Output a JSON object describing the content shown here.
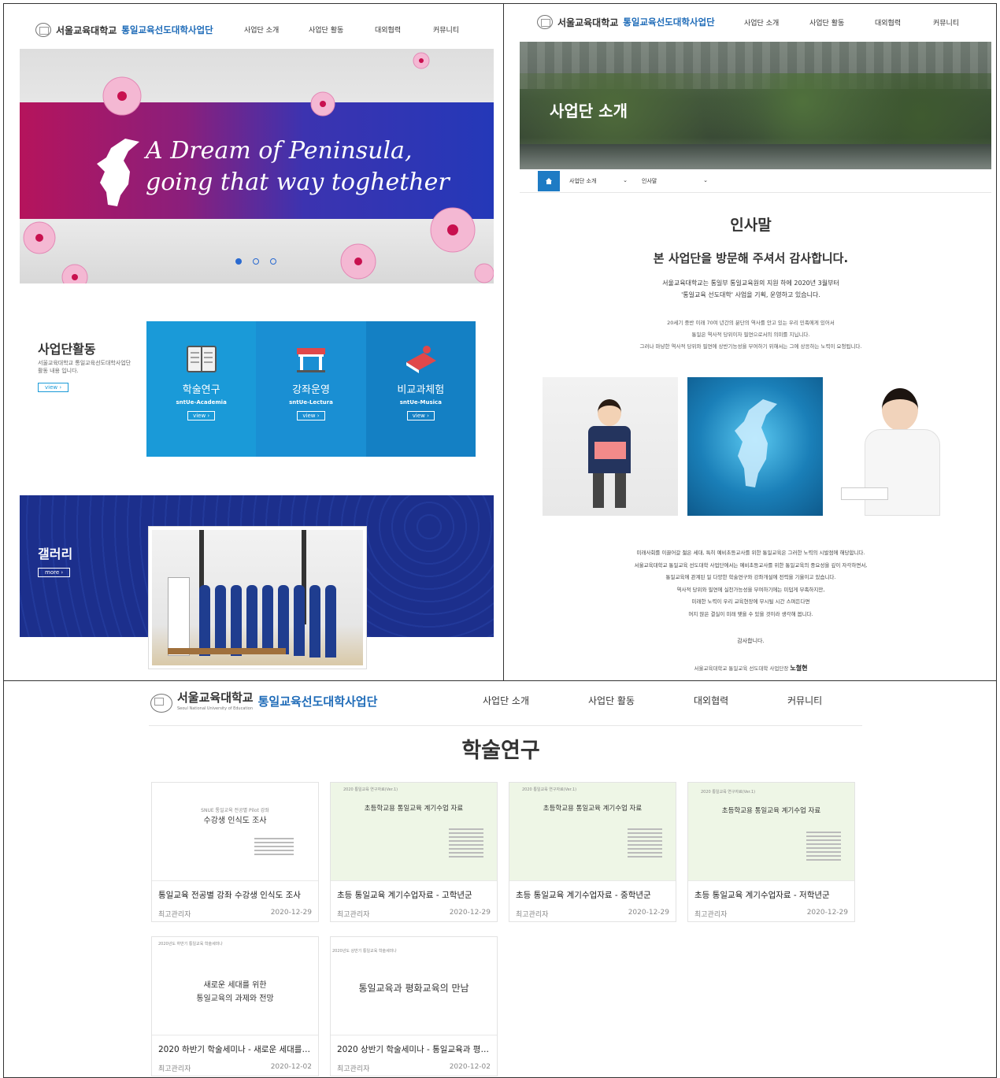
{
  "home": {
    "logo_ko": "서울교육대학교",
    "logo_unit": "통일교육선도대학사업단",
    "nav": [
      "사업단 소개",
      "사업단 활동",
      "대외협력",
      "커뮤니티"
    ],
    "hero_line1": "A Dream of Peninsula,",
    "hero_line2": "going that way toghether",
    "activity_title": "사업단활동",
    "activity_desc1": "서울교육대학교 통일교육선도대학사업단",
    "activity_desc2": "활동 내용 입니다.",
    "view_label": "view",
    "tiles": [
      {
        "title": "학술연구",
        "sub": "sntUe-Academia",
        "btn": "view"
      },
      {
        "title": "강좌운영",
        "sub": "sntUe-Lectura",
        "btn": "view"
      },
      {
        "title": "비교과체험",
        "sub": "sntUe-Musica",
        "btn": "view"
      }
    ],
    "gallery_title": "갤러리",
    "more_label": "more"
  },
  "about": {
    "logo_ko": "서울교육대학교",
    "logo_unit": "통일교육선도대학사업단",
    "nav": [
      "사업단 소개",
      "사업단 활동",
      "대외협력",
      "커뮤니티"
    ],
    "banner_title": "사업단 소개",
    "crumb1": "사업단 소개",
    "crumb2": "인사말",
    "heading": "인사말",
    "subheading": "본 사업단을 방문해 주셔서 감사합니다.",
    "intro1": "서울교육대학교는 통일부 통일교육원의 지원 하에 2020년 3월부터",
    "intro2": "'통일교육 선도대학' 사업을 기획, 운영하고 있습니다.",
    "p1": "20세기 중반 이래 70여 년간의 분단의 역사를 안고 있는 우리 민족에게 있어서",
    "p2": "통일은 역사적 당위이자 필연으로서의 의미를 지닙니다.",
    "p3": "그러나 마냥한 역사적 당위와 필연에 상반기능성을 부여하기 위해서는 그에 상응하는 노력이 요청됩니다.",
    "q1": "미래사회를 이끌어갈 젊은 세대, 특히 예비초등교사를 위한 통일교육은 그러한 노력의 시발점에 해당합니다.",
    "q2": "서울교육대학교 통일교육 선도대학 사업단에서는 예비초등교사를 위한 통일교육의 중요성을 깊이 자각하면서,",
    "q3": "통일교육에 관계된 일 다양한 학술연구와 강좌개설에 전력을 기울이고 있습니다.",
    "q4": "역사적 당위와 필연에 실천가능성을 부여하기에는 미덥게 부족하지만,",
    "q5": "미래한 노력이 우리 교육현장에 무시될 시간 스며든다면",
    "q6": "머지 않은 결실이 미래 맺을 수 있을 것이라 생각해 봅니다.",
    "thanks": "감사합니다.",
    "sign_prefix": "서울교육대학교 통일교육 선도대학 사업단장",
    "sign_name": "노철현"
  },
  "academic": {
    "logo_ko": "서울교육대학교",
    "logo_en": "Seoul National University of Education",
    "logo_unit": "통일교육선도대학사업단",
    "nav": [
      "사업단 소개",
      "사업단 활동",
      "대외협력",
      "커뮤니티"
    ],
    "page_title": "학술연구",
    "cards": [
      {
        "thumb_small": "SNUE 통일교육 전공별 Pilot 강좌",
        "thumb_title": "수강생 인식도 조사",
        "title": "통일교육 전공별 강좌 수강생 인식도 조사",
        "author": "최고관리자",
        "date": "2020-12-29"
      },
      {
        "thumb_small": "2020 통일교육 연구자료(Ver.1)",
        "thumb_title": "초등학교용 통일교육 계기수업 자료",
        "title": "초등 통일교육 계기수업자료 - 고학년군",
        "author": "최고관리자",
        "date": "2020-12-29"
      },
      {
        "thumb_small": "2020 통일교육 연구자료(Ver.1)",
        "thumb_title": "초등학교용 통일교육 계기수업 자료",
        "title": "초등 통일교육 계기수업자료 - 중학년군",
        "author": "최고관리자",
        "date": "2020-12-29"
      },
      {
        "thumb_small": "2020 통일교육 연구자료(Ver.1)",
        "thumb_title": "초등학교용 통일교육 계기수업 자료",
        "title": "초등 통일교육 계기수업자료 - 저학년군",
        "author": "최고관리자",
        "date": "2020-12-29"
      },
      {
        "thumb_small": "2020년도 하반기 통일교육 학술세미나",
        "thumb_title": "새로운 세대를 위한",
        "thumb_title2": "통일교육의 과제와 전망",
        "title": "2020 하반기 학술세미나 - 새로운 세대를…",
        "author": "최고관리자",
        "date": "2020-12-02"
      },
      {
        "thumb_small": "2020년도 상반기 통일교육 학술세미나",
        "thumb_title": "통일교육과 평화교육의 만남",
        "title": "2020 상반기 학술세미나 - 통일교육과 평…",
        "author": "최고관리자",
        "date": "2020-12-02"
      }
    ]
  },
  "colors": {
    "brand_blue": "#1e6bb8",
    "tile_blue": "#1a9ad8",
    "tile_blue_dark": "#1480c4",
    "gallery_navy": "#1c2f8c",
    "hero_magenta": "#b5145c",
    "hero_blue": "#2438b8"
  }
}
